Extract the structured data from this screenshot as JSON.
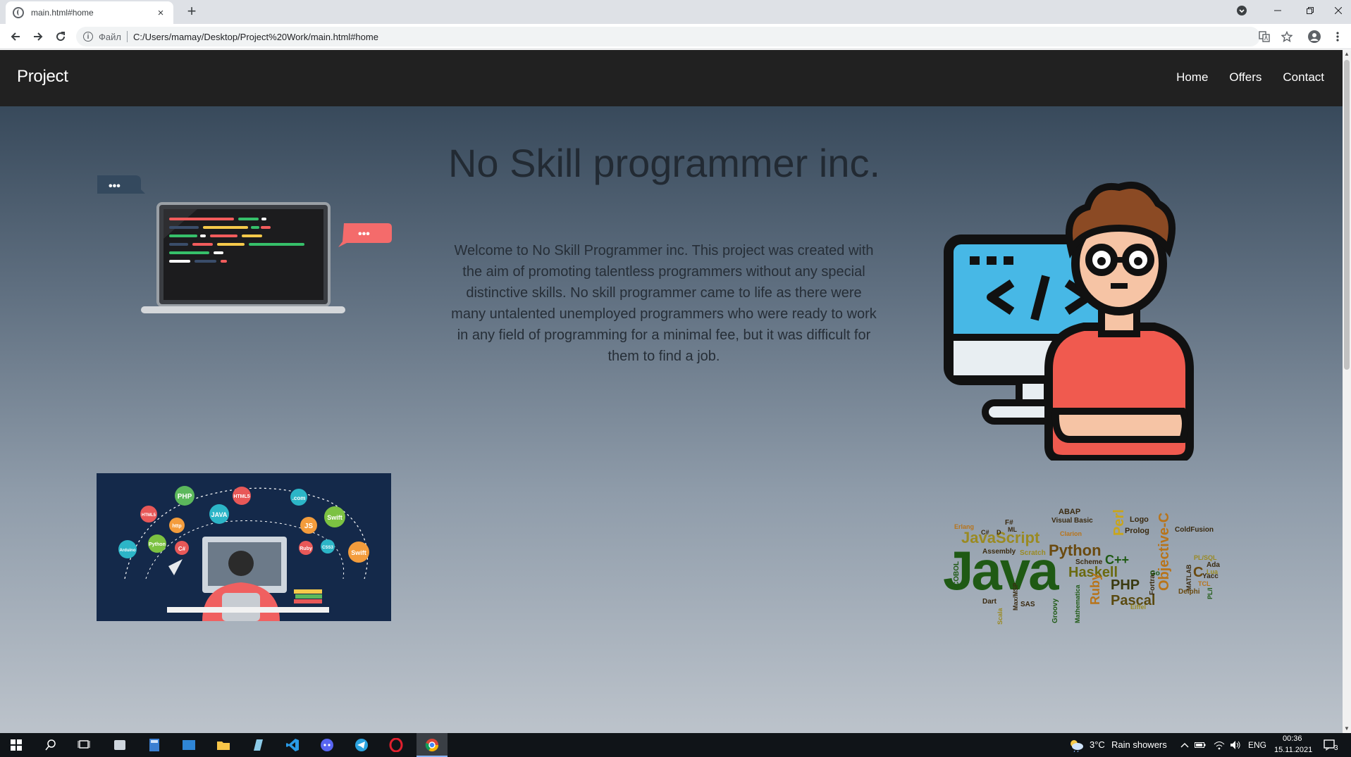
{
  "browser": {
    "tab_title": "main.html#home",
    "tab_close": "×",
    "new_tab": "+",
    "scheme_label": "Файл",
    "url": "C:/Users/mamay/Desktop/Project%20Work/main.html#home"
  },
  "site": {
    "brand": "Project",
    "nav": [
      "Home",
      "Offers",
      "Contact"
    ],
    "hero_title": "No Skill programmer inc.",
    "hero_text": "Welcome to No Skill Programmer inc. This project was created with the aim of promoting talentless programmers without any special distinctive skills. No skill programmer came to life as there were many untalented unemployed programmers who were ready to work in any field of programming for a minimal fee, but it was difficult for them to find a job."
  },
  "illustrations": {
    "langs_bubbles": [
      "PHP",
      "HTML5",
      ".com",
      "JAVA",
      "Swift",
      "http",
      "JS",
      "Python",
      "C#",
      "Arduino",
      "Ruby",
      "CSS3",
      "HTML5",
      "Swift"
    ],
    "cloud_words": [
      "Java",
      "JavaScript",
      "Python",
      "Haskell",
      "PHP",
      "Pascal",
      "Objective-C",
      "C++",
      "Perl",
      "Ruby",
      "C",
      "Prolog",
      "Logo",
      "ABAP",
      "Visual Basic",
      "ColdFusion",
      "COBOL",
      "Erlang",
      "F#",
      "ML",
      "Clarion",
      "Scheme",
      "Assembly",
      "Scratch",
      "Fortran",
      "Go",
      "MATLAB",
      "Yacc",
      "TCL",
      "Delphi",
      "Ada",
      "Lua",
      "PL/SQL",
      "Scala",
      "SAS",
      "Groovy",
      "Mathematica",
      "Dart",
      "Max/MSP",
      "PL/I",
      "Eiffel",
      "C#",
      "D"
    ],
    "laptop_dots": "•••"
  },
  "taskbar": {
    "weather_temp": "3°C",
    "weather_text": "Rain showers",
    "lang": "ENG",
    "time": "00:36",
    "date": "15.11.2021",
    "notifications": "3"
  },
  "colors": {
    "navbar": "#212121",
    "gradient_top": "#2c3e50",
    "gradient_bottom": "#bcc3cb",
    "java_green": "#1f5a14",
    "cloud_orange": "#b8741a"
  }
}
